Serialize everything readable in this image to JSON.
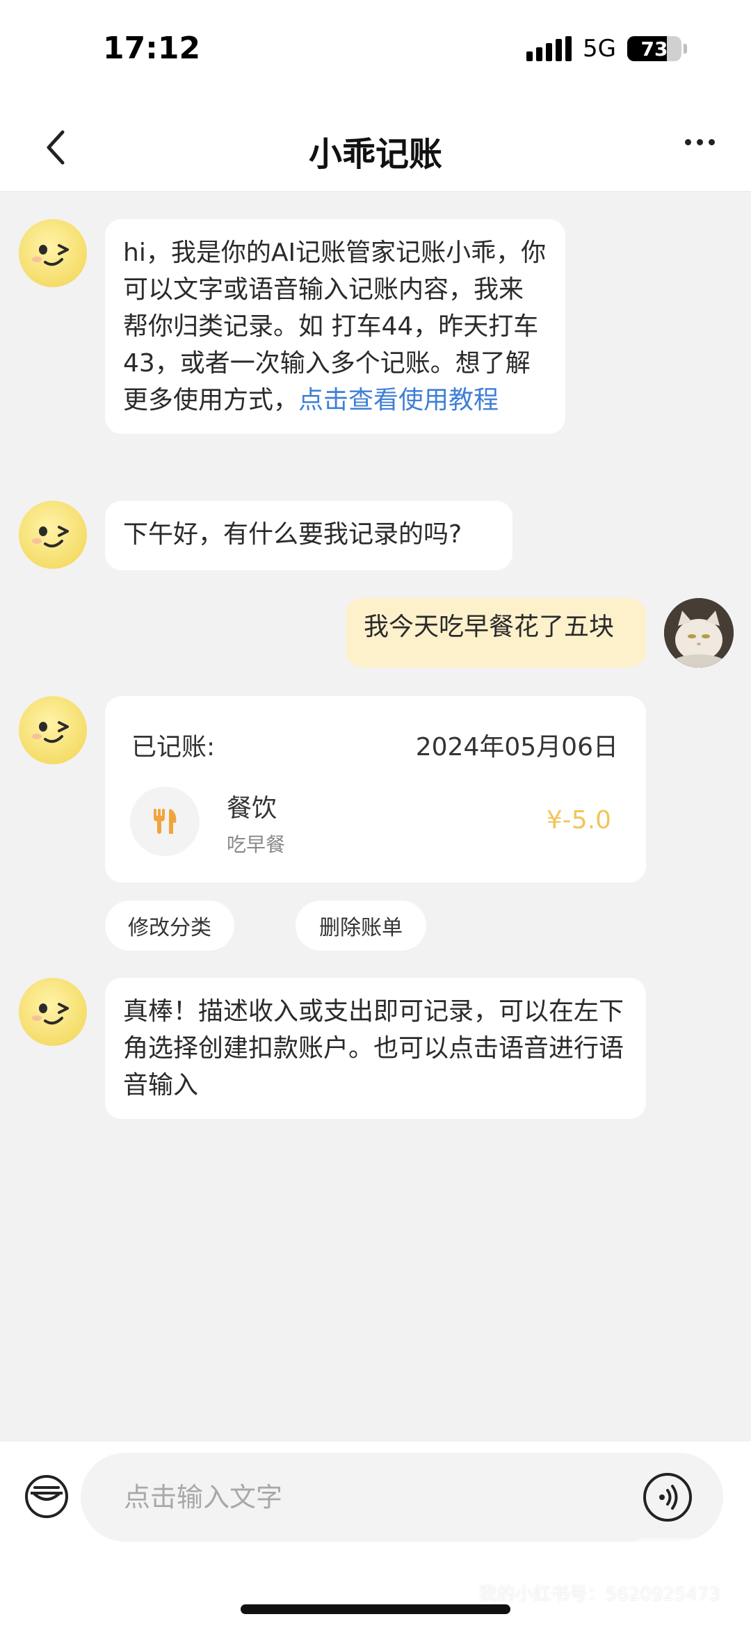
{
  "status_bar": {
    "time": "17:12",
    "network": "5G",
    "battery": "73"
  },
  "header": {
    "title": "小乖记账",
    "back_icon": "chevron-left-icon",
    "more_icon": "more-dots-icon"
  },
  "messages": {
    "welcome": {
      "text": "hi，我是你的AI记账管家记账小乖，你可以文字或语音输入记账内容，我来帮你归类记录。如 打车44，昨天打车43，或者一次输入多个记账。想了解更多使用方式，",
      "link": "点击查看使用教程"
    },
    "greeting": "下午好，有什么要我记录的吗?",
    "user_message": "我今天吃早餐花了五块",
    "record_card": {
      "label": "已记账:",
      "date": "2024年05月06日",
      "category": "餐饮",
      "note": "吃早餐",
      "amount": "¥-5.0",
      "category_icon": "fork-knife-icon"
    },
    "actions": {
      "edit": "修改分类",
      "delete": "删除账单"
    },
    "tip": "真棒！描述收入或支出即可记录，可以在左下角选择创建扣款账户。也可以点击语音进行语音输入"
  },
  "input_bar": {
    "placeholder": "点击输入文字",
    "wallet_icon": "wallet-icon",
    "voice_icon": "voice-icon"
  },
  "watermark": {
    "logo": "小红书",
    "text": "我的小红书号：5620925473"
  },
  "colors": {
    "accent_link": "#3f7fd6",
    "amount": "#f2c45a",
    "user_bubble": "#fdf1cc",
    "bot_avatar": "#f5dd6a"
  }
}
